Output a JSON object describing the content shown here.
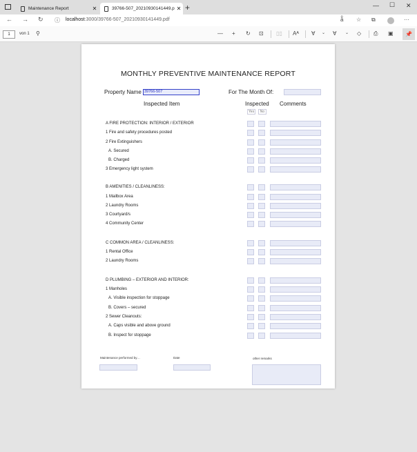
{
  "browser": {
    "tabs": [
      {
        "label": "Maintenance Report",
        "active": false
      },
      {
        "label": "39766-507_20210930141449.pdf",
        "active": true
      }
    ],
    "url_host": "localhost",
    "url_path": ":3000/39766-507_20210930141449.pdf"
  },
  "pdf_toolbar": {
    "page_number": "1",
    "page_count": "von 1"
  },
  "document": {
    "title": "MONTHLY PREVENTIVE MAINTENANCE REPORT",
    "property_label": "Property Name",
    "property_value": "39766-507",
    "month_label": "For The Month Of:",
    "month_value": "",
    "col_item": "Inspected Item",
    "col_inspected": "Inspected",
    "col_comments": "Comments",
    "yes": "Yes",
    "no": "No",
    "rows": [
      {
        "text": "A FIRE PROTECTION: INTERIOR / EXTERIOR"
      },
      {
        "text": "1 Fire and safety procedures posted"
      },
      {
        "text": "2 Fire Extinguishers"
      },
      {
        "text": "A. Secured",
        "indent": true
      },
      {
        "text": "B. Charged",
        "indent": true
      },
      {
        "text": "3 Emergency light system"
      },
      {
        "text": "B AMENITIES / CLEANLINESS:"
      },
      {
        "text": "1 Mailbox Area"
      },
      {
        "text": "2 Laundry Rooms"
      },
      {
        "text": "3 Courtyard/s"
      },
      {
        "text": "4 Community Center"
      },
      {
        "text": "C COMMON AREA / CLEANLINESS:"
      },
      {
        "text": "1 Rental Office"
      },
      {
        "text": "2 Laundry Rooms"
      },
      {
        "text": "D PLUMBING – EXTERIOR AND INTERIOR:"
      },
      {
        "text": "1 Manholes"
      },
      {
        "text": "A. Visible inspection for stoppage",
        "indent": true
      },
      {
        "text": "B. Covers – secured",
        "indent": true
      },
      {
        "text": "2 Sewer Cleanouts:"
      },
      {
        "text": "A. Caps visible and above ground",
        "indent": true
      },
      {
        "text": "B. Inspect for stoppage",
        "indent": true
      }
    ],
    "footer": {
      "performed_by": "Maintenance performed by…",
      "date": "Date",
      "remarks": "other remarks"
    }
  }
}
